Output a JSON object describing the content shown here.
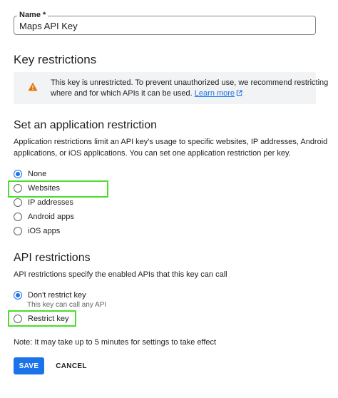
{
  "name_field": {
    "label": "Name *",
    "value": "Maps API Key"
  },
  "key_restrictions": {
    "heading": "Key restrictions",
    "warning": {
      "icon": "warning-icon",
      "icon_color": "#e37400",
      "line1": "This key is unrestricted. To prevent unauthorized use, we recommend restricting",
      "line2_prefix": "where and for which APIs it can be used.",
      "link_label": "Learn more",
      "link_icon": "open-in-new-icon"
    }
  },
  "application_restriction": {
    "heading": "Set an application restriction",
    "description_line1": "Application restrictions limit an API key's usage to specific websites, IP addresses, Android",
    "description_line2": "applications, or iOS applications. You can set one application restriction per key.",
    "options": [
      {
        "label": "None",
        "checked": true
      },
      {
        "label": "Websites",
        "checked": false,
        "highlighted": true
      },
      {
        "label": "IP addresses",
        "checked": false
      },
      {
        "label": "Android apps",
        "checked": false
      },
      {
        "label": "iOS apps",
        "checked": false
      }
    ]
  },
  "api_restrictions": {
    "heading": "API restrictions",
    "description": "API restrictions specify the enabled APIs that this key can call",
    "options": [
      {
        "label": "Don't restrict key",
        "sublabel": "This key can call any API",
        "checked": true
      },
      {
        "label": "Restrict key",
        "checked": false,
        "highlighted": true
      }
    ]
  },
  "note": "Note: It may take up to 5 minutes for settings to take effect",
  "actions": {
    "save_label": "SAVE",
    "cancel_label": "CANCEL"
  },
  "colors": {
    "accent": "#1a73e8",
    "highlight": "#4cdd2a",
    "warning": "#e37400"
  }
}
